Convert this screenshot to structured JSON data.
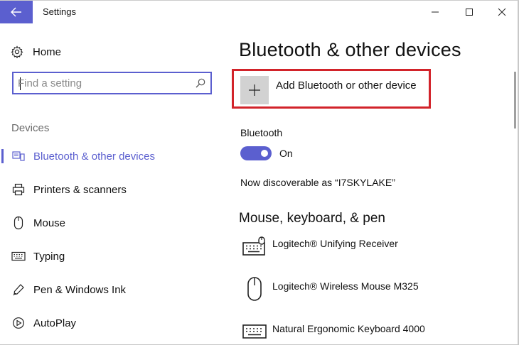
{
  "window": {
    "title": "Settings"
  },
  "sidebar": {
    "home_label": "Home",
    "search": {
      "placeholder": "Find a setting",
      "value": ""
    },
    "section_label": "Devices",
    "items": [
      {
        "label": "Bluetooth & other devices",
        "icon": "bluetooth-devices-icon",
        "active": true
      },
      {
        "label": "Printers & scanners",
        "icon": "printer-icon",
        "active": false
      },
      {
        "label": "Mouse",
        "icon": "mouse-icon",
        "active": false
      },
      {
        "label": "Typing",
        "icon": "keyboard-icon",
        "active": false
      },
      {
        "label": "Pen & Windows Ink",
        "icon": "pen-icon",
        "active": false
      },
      {
        "label": "AutoPlay",
        "icon": "autoplay-icon",
        "active": false
      }
    ]
  },
  "main": {
    "title": "Bluetooth & other devices",
    "add_device_label": "Add Bluetooth or other device",
    "bluetooth": {
      "label": "Bluetooth",
      "state": "On",
      "enabled": true
    },
    "discoverable_text": "Now discoverable as “I7SKYLAKE”",
    "section_heading": "Mouse, keyboard, & pen",
    "devices": [
      {
        "name": "Logitech® Unifying Receiver",
        "icon": "keyboard-mouse-icon"
      },
      {
        "name": "Logitech® Wireless Mouse M325",
        "icon": "mouse-icon"
      },
      {
        "name": "Natural Ergonomic Keyboard 4000",
        "icon": "keyboard-icon"
      }
    ]
  },
  "colors": {
    "accent": "#5b5fcf",
    "highlight_box": "#d2232a",
    "plus_tile": "#d2d2d2"
  }
}
